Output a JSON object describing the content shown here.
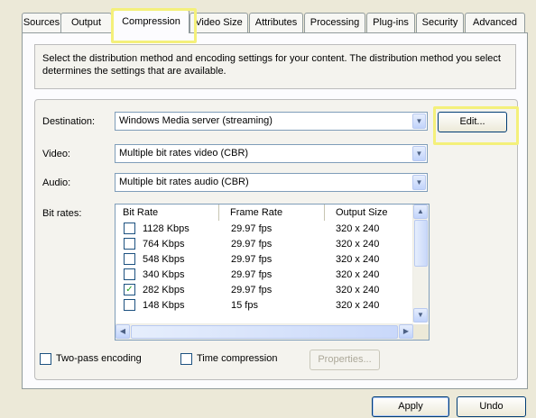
{
  "tabs": [
    "Sources",
    "Output",
    "Compression",
    "Video Size",
    "Attributes",
    "Processing",
    "Plug-ins",
    "Security",
    "Advanced"
  ],
  "active_tab": "Compression",
  "description": "Select the distribution method and encoding settings for your content. The distribution method you select determines the settings that are available.",
  "destination": {
    "label": "Destination:",
    "value": "Windows Media server (streaming)",
    "edit_label": "Edit..."
  },
  "video": {
    "label": "Video:",
    "value": "Multiple bit rates video (CBR)"
  },
  "audio": {
    "label": "Audio:",
    "value": "Multiple bit rates audio (CBR)"
  },
  "bitrates": {
    "label": "Bit rates:",
    "columns": [
      "Bit Rate",
      "Frame Rate",
      "Output Size"
    ],
    "rows": [
      {
        "rate": "1128 Kbps",
        "fps": "29.97 fps",
        "size": "320 x 240",
        "checked": false
      },
      {
        "rate": "764 Kbps",
        "fps": "29.97 fps",
        "size": "320 x 240",
        "checked": false
      },
      {
        "rate": "548 Kbps",
        "fps": "29.97 fps",
        "size": "320 x 240",
        "checked": false
      },
      {
        "rate": "340 Kbps",
        "fps": "29.97 fps",
        "size": "320 x 240",
        "checked": false
      },
      {
        "rate": "282 Kbps",
        "fps": "29.97 fps",
        "size": "320 x 240",
        "checked": true
      },
      {
        "rate": "148 Kbps",
        "fps": "15 fps",
        "size": "320 x 240",
        "checked": false
      }
    ]
  },
  "options": {
    "two_pass": "Two-pass encoding",
    "time_compression": "Time compression",
    "properties": "Properties..."
  },
  "buttons": {
    "apply": "Apply",
    "undo": "Undo"
  },
  "highlight_color": "#f4f07a"
}
